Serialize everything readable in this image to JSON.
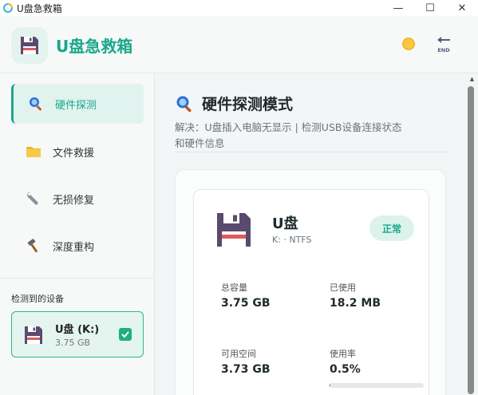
{
  "window": {
    "title": "U盘急救箱",
    "minimize_glyph": "—",
    "maximize_glyph": "☐",
    "close_glyph": "✕"
  },
  "header": {
    "brand": "U盘急救箱",
    "theme_icon": "sun-icon",
    "exit_icon": "end-icon",
    "exit_label": "END"
  },
  "sidebar": {
    "items": [
      {
        "label": "硬件探测",
        "icon": "magnifier-icon",
        "active": true
      },
      {
        "label": "文件救援",
        "icon": "folder-icon",
        "active": false
      },
      {
        "label": "无损修复",
        "icon": "wrench-icon",
        "active": false
      },
      {
        "label": "深度重构",
        "icon": "hammer-icon",
        "active": false
      }
    ],
    "devices_title": "检测到的设备",
    "device": {
      "name": "U盘 (K:)",
      "size": "3.75 GB",
      "checked": true
    }
  },
  "main": {
    "title": "硬件探测模式",
    "desc_line1": "解决：U盘插入电脑无显示 | 检测USB设备连接状态",
    "desc_line2": "和硬件信息",
    "drive": {
      "name": "U盘",
      "meta": "K: · NTFS",
      "status": "正常",
      "stats": {
        "total_label": "总容量",
        "total_value": "3.75 GB",
        "used_label": "已使用",
        "used_value": "18.2 MB",
        "free_label": "可用空间",
        "free_value": "3.73 GB",
        "usage_label": "使用率",
        "usage_value": "0.5%"
      },
      "usage_fraction": 0.005
    }
  },
  "colors": {
    "accent": "#1aa78b",
    "accent_light": "#e1f3ee",
    "disk_body": "#5a4a6e",
    "disk_stripe": "#e05a5a"
  }
}
